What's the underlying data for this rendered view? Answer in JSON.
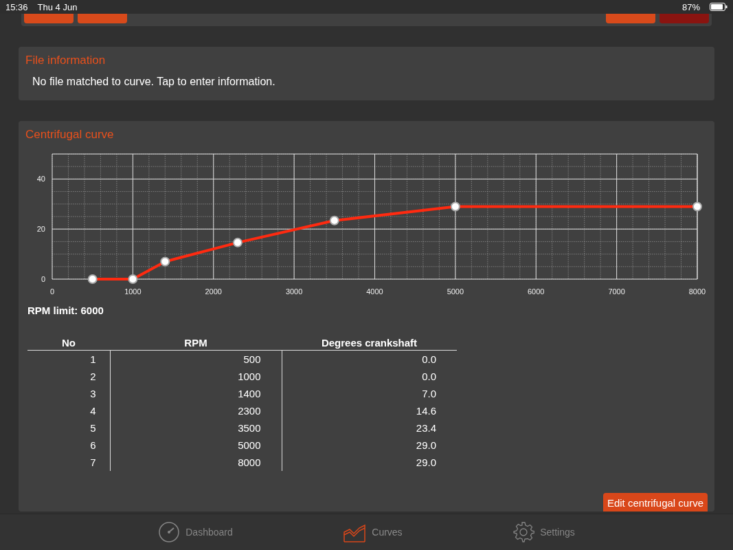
{
  "status_bar": {
    "time": "15:36",
    "date": "Thu 4 Jun",
    "battery": "87%"
  },
  "top_buttons": [
    {
      "color": "#d84a1b"
    },
    {
      "color": "#d84a1b"
    },
    {
      "color": "#d84a1b"
    },
    {
      "color": "#8a1410"
    }
  ],
  "file_information": {
    "title": "File information",
    "message": "No file matched to curve. Tap to enter information."
  },
  "curve": {
    "title": "Centrifugal curve",
    "chart_data": {
      "type": "line",
      "x": [
        500,
        1000,
        1400,
        2300,
        3500,
        5000,
        8000
      ],
      "series": [
        {
          "color": "#ff2a10",
          "marker": true,
          "values": [
            0.0,
            0.0,
            7.0,
            14.6,
            23.4,
            29.0,
            29.0
          ]
        }
      ],
      "grid": true,
      "xlim": [
        0,
        8000
      ],
      "ylim": [
        0,
        50
      ],
      "xticks": [
        0,
        1000,
        2000,
        3000,
        4000,
        5000,
        6000,
        7000,
        8000
      ],
      "yticks": [
        0,
        20,
        40
      ]
    },
    "rpm_limit": "RPM limit: 6000",
    "table": {
      "columns": [
        "No",
        "RPM",
        "Degrees crankshaft"
      ],
      "rows": [
        [
          "1",
          "500",
          "0.0"
        ],
        [
          "2",
          "1000",
          "0.0"
        ],
        [
          "3",
          "1400",
          "7.0"
        ],
        [
          "4",
          "2300",
          "14.6"
        ],
        [
          "5",
          "3500",
          "23.4"
        ],
        [
          "6",
          "5000",
          "29.0"
        ],
        [
          "7",
          "8000",
          "29.0"
        ]
      ]
    },
    "edit_button": "Edit centrifugal curve"
  },
  "tabs": [
    {
      "label": "Dashboard",
      "selected": false
    },
    {
      "label": "Curves",
      "selected": true
    },
    {
      "label": "Settings",
      "selected": false
    }
  ]
}
